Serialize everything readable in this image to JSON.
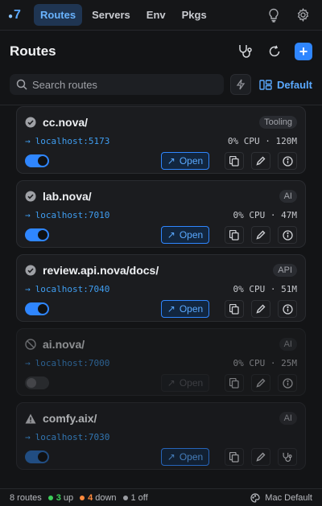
{
  "nav": {
    "logo": "7",
    "tabs": [
      "Routes",
      "Servers",
      "Env",
      "Pkgs"
    ],
    "active_tab": "Routes"
  },
  "header": {
    "title": "Routes"
  },
  "search": {
    "placeholder": "Search routes"
  },
  "layout": {
    "label": "Default"
  },
  "routes": [
    {
      "name": "cc.nova/",
      "tag": "Tooling",
      "port": "localhost:5173",
      "stats": "0% CPU · 120M",
      "status": "ok",
      "enabled": true,
      "open_label": "Open"
    },
    {
      "name": "lab.nova/",
      "tag": "AI",
      "port": "localhost:7010",
      "stats": "0% CPU · 47M",
      "status": "ok",
      "enabled": true,
      "open_label": "Open"
    },
    {
      "name": "review.api.nova/docs/",
      "tag": "API",
      "port": "localhost:7040",
      "stats": "0% CPU · 51M",
      "status": "ok",
      "enabled": true,
      "open_label": "Open"
    },
    {
      "name": "ai.nova/",
      "tag": "AI",
      "port": "localhost:7000",
      "stats": "0% CPU · 25M",
      "status": "off",
      "enabled": false,
      "open_label": "Open"
    },
    {
      "name": "comfy.aix/",
      "tag": "AI",
      "port": "localhost:7030",
      "stats": "",
      "status": "warn",
      "enabled": true,
      "open_label": "Open"
    }
  ],
  "footer": {
    "routes_count": "8 routes",
    "up": "3",
    "up_label": "up",
    "down": "4",
    "down_label": "down",
    "off": "1",
    "off_label": "off",
    "profile": "Mac Default"
  },
  "colors": {
    "accent": "#2f86ff",
    "up": "#3ccf5a",
    "down": "#ff8a3d",
    "off": "#9a9ca2"
  }
}
